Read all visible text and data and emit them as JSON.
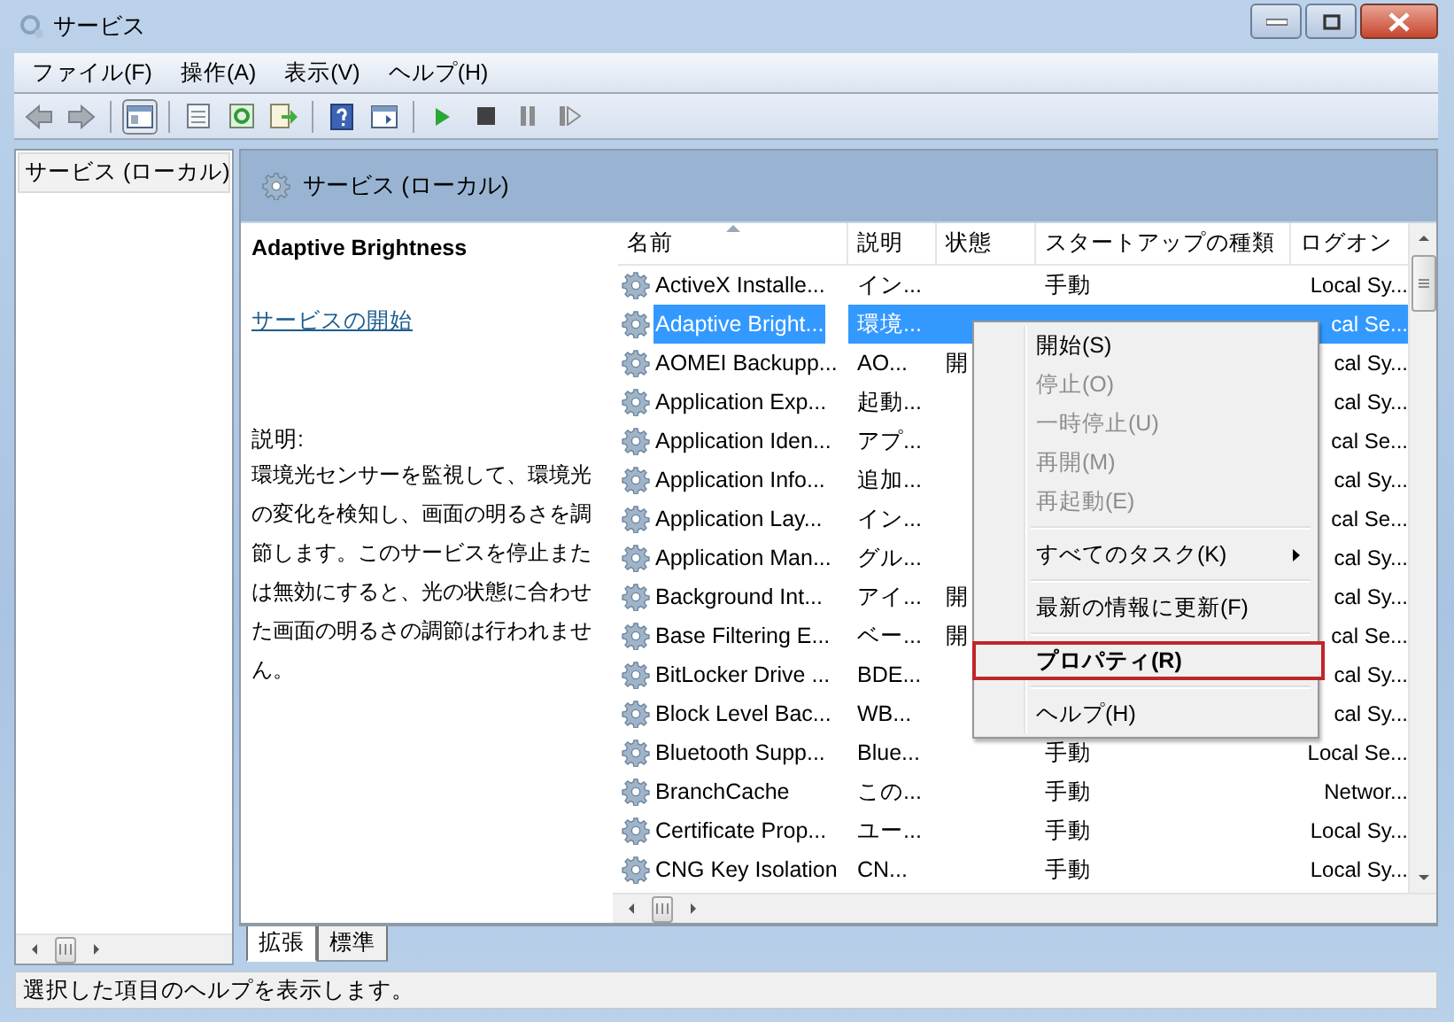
{
  "window": {
    "title": "サービス"
  },
  "menu_bar": [
    "ファイル(F)",
    "操作(A)",
    "表示(V)",
    "ヘルプ(H)"
  ],
  "tree": {
    "items": [
      {
        "label": "サービス (ローカル)",
        "selected": true
      }
    ]
  },
  "panel": {
    "title": "サービス (ローカル)"
  },
  "details": {
    "service_name": "Adaptive Brightness",
    "link": "サービスの開始",
    "description_label": "説明:",
    "description": "環境光センサーを監視して、環境光の変化を検知し、画面の明るさを調節します。このサービスを停止または無効にすると、光の状態に合わせた画面の明るさの調節は行われません。"
  },
  "table": {
    "columns": [
      {
        "label": "名前",
        "sorted": true
      },
      {
        "label": "説明",
        "sorted": false
      },
      {
        "label": "状態",
        "sorted": false
      },
      {
        "label": "スタートアップの種類",
        "sorted": false
      },
      {
        "label": "ログオン",
        "sorted": false
      }
    ],
    "rows": [
      {
        "name": "ActiveX Installe...",
        "description": "イン...",
        "status": "",
        "startup": "手動",
        "logon": "Local Sy...",
        "selected": false
      },
      {
        "name": "Adaptive Bright...",
        "description": "環境...",
        "status": "",
        "startup": "",
        "logon": "cal Se...",
        "selected": true
      },
      {
        "name": "AOMEI Backupp...",
        "description": "AO...",
        "status": "開",
        "startup": "",
        "logon": "cal Sy...",
        "selected": false
      },
      {
        "name": "Application Exp...",
        "description": "起動...",
        "status": "",
        "startup": "",
        "logon": "cal Sy...",
        "selected": false
      },
      {
        "name": "Application Iden...",
        "description": "アプ...",
        "status": "",
        "startup": "",
        "logon": "cal Se...",
        "selected": false
      },
      {
        "name": "Application Info...",
        "description": "追加...",
        "status": "",
        "startup": "",
        "logon": "cal Sy...",
        "selected": false
      },
      {
        "name": "Application Lay...",
        "description": "イン...",
        "status": "",
        "startup": "",
        "logon": "cal Se...",
        "selected": false
      },
      {
        "name": "Application Man...",
        "description": "グル...",
        "status": "",
        "startup": "",
        "logon": "cal Sy...",
        "selected": false
      },
      {
        "name": "Background Int...",
        "description": "アイ...",
        "status": "開",
        "startup": "",
        "logon": "cal Sy...",
        "selected": false
      },
      {
        "name": "Base Filtering E...",
        "description": "ベー...",
        "status": "開",
        "startup": "",
        "logon": "cal Se...",
        "selected": false
      },
      {
        "name": "BitLocker Drive ...",
        "description": "BDE...",
        "status": "",
        "startup": "",
        "logon": "cal Sy...",
        "selected": false
      },
      {
        "name": "Block Level Bac...",
        "description": "WB...",
        "status": "",
        "startup": "",
        "logon": "cal Sy...",
        "selected": false
      },
      {
        "name": "Bluetooth Supp...",
        "description": "Blue...",
        "status": "",
        "startup": "手動",
        "logon": "Local Se...",
        "selected": false
      },
      {
        "name": "BranchCache",
        "description": "この...",
        "status": "",
        "startup": "手動",
        "logon": "Networ...",
        "selected": false
      },
      {
        "name": "Certificate Prop...",
        "description": "ユー...",
        "status": "",
        "startup": "手動",
        "logon": "Local Sy...",
        "selected": false
      },
      {
        "name": "CNG Key Isolation",
        "description": "CN...",
        "status": "",
        "startup": "手動",
        "logon": "Local Sy...",
        "selected": false
      }
    ]
  },
  "context_menu": {
    "items": [
      {
        "kind": "item",
        "label": "開始(S)",
        "disabled": false,
        "submenu": false,
        "default": false,
        "highlighted": false
      },
      {
        "kind": "item",
        "label": "停止(O)",
        "disabled": true,
        "submenu": false,
        "default": false,
        "highlighted": false
      },
      {
        "kind": "item",
        "label": "一時停止(U)",
        "disabled": true,
        "submenu": false,
        "default": false,
        "highlighted": false
      },
      {
        "kind": "item",
        "label": "再開(M)",
        "disabled": true,
        "submenu": false,
        "default": false,
        "highlighted": false
      },
      {
        "kind": "item",
        "label": "再起動(E)",
        "disabled": true,
        "submenu": false,
        "default": false,
        "highlighted": false
      },
      {
        "kind": "separator"
      },
      {
        "kind": "item",
        "label": "すべてのタスク(K)",
        "disabled": false,
        "submenu": true,
        "default": false,
        "highlighted": false
      },
      {
        "kind": "separator"
      },
      {
        "kind": "item",
        "label": "最新の情報に更新(F)",
        "disabled": false,
        "submenu": false,
        "default": false,
        "highlighted": false
      },
      {
        "kind": "separator"
      },
      {
        "kind": "item",
        "label": "プロパティ(R)",
        "disabled": false,
        "submenu": false,
        "default": true,
        "highlighted": true
      },
      {
        "kind": "separator"
      },
      {
        "kind": "item",
        "label": "ヘルプ(H)",
        "disabled": false,
        "submenu": false,
        "default": false,
        "highlighted": false
      }
    ]
  },
  "tabs": [
    {
      "label": "拡張",
      "selected": true
    },
    {
      "label": "標準",
      "selected": false
    }
  ],
  "status_bar": "選択した項目のヘルプを表示します。"
}
